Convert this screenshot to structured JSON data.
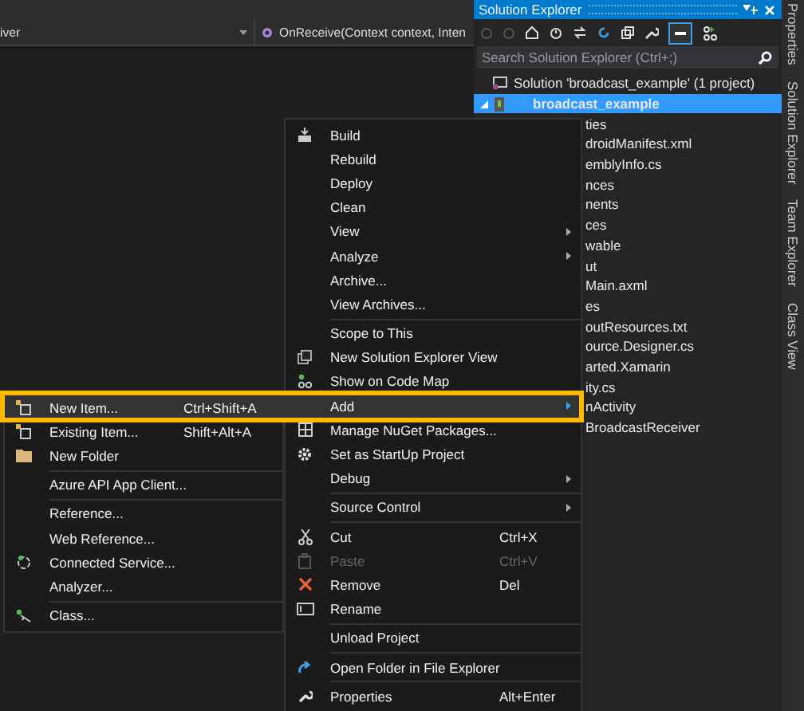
{
  "editor": {
    "type_dropdown": "iver",
    "member_dropdown": "OnReceive(Context context, Inten"
  },
  "solution_explorer": {
    "title": "Solution Explorer",
    "search": {
      "placeholder": "Search Solution Explorer (Ctrl+;)"
    },
    "tree": [
      {
        "label": "Solution 'broadcast_example' (1 project)",
        "selected": false,
        "kind": "solution"
      },
      {
        "label": "broadcast_example",
        "selected": true,
        "kind": "project"
      },
      {
        "label": "ties",
        "selected": false,
        "kind": "file"
      },
      {
        "label": "droidManifest.xml",
        "selected": false,
        "kind": "file"
      },
      {
        "label": "emblyInfo.cs",
        "selected": false,
        "kind": "file"
      },
      {
        "label": "nces",
        "selected": false,
        "kind": "file"
      },
      {
        "label": "nents",
        "selected": false,
        "kind": "file"
      },
      {
        "label": "ces",
        "selected": false,
        "kind": "gap"
      },
      {
        "label": "wable",
        "selected": false,
        "kind": "file"
      },
      {
        "label": "ut",
        "selected": false,
        "kind": "file"
      },
      {
        "label": "Main.axml",
        "selected": false,
        "kind": "file"
      },
      {
        "label": "es",
        "selected": false,
        "kind": "file"
      },
      {
        "label": "outResources.txt",
        "selected": false,
        "kind": "file"
      },
      {
        "label": "ource.Designer.cs",
        "selected": false,
        "kind": "file"
      },
      {
        "label": "arted.Xamarin",
        "selected": false,
        "kind": "file"
      },
      {
        "label": "ity.cs",
        "selected": false,
        "kind": "file"
      },
      {
        "label": "nActivity",
        "selected": false,
        "kind": "file"
      },
      {
        "label": "BroadcastReceiver",
        "selected": false,
        "kind": "file"
      }
    ]
  },
  "side_tabs": [
    "Properties",
    "Solution Explorer",
    "Team Explorer",
    "Class View"
  ],
  "context_menu": [
    {
      "kind": "item",
      "label": "Build",
      "submenu": false,
      "disabled": false,
      "selected": false
    },
    {
      "kind": "item",
      "label": "Rebuild",
      "submenu": false,
      "disabled": false,
      "selected": false
    },
    {
      "kind": "item",
      "label": "Deploy",
      "submenu": false,
      "disabled": false,
      "selected": false
    },
    {
      "kind": "item",
      "label": "Clean",
      "submenu": false,
      "disabled": false,
      "selected": false
    },
    {
      "kind": "item",
      "label": "View",
      "submenu": true,
      "disabled": false,
      "selected": false
    },
    {
      "kind": "item",
      "label": "Analyze",
      "submenu": true,
      "disabled": false,
      "selected": false
    },
    {
      "kind": "item",
      "label": "Archive...",
      "submenu": false,
      "disabled": false,
      "selected": false
    },
    {
      "kind": "item",
      "label": "View Archives...",
      "submenu": false,
      "disabled": false,
      "selected": false
    },
    {
      "kind": "separator"
    },
    {
      "kind": "item",
      "label": "Scope to This",
      "submenu": false,
      "disabled": false,
      "selected": false
    },
    {
      "kind": "item",
      "label": "New Solution Explorer View",
      "submenu": false,
      "disabled": false,
      "selected": false
    },
    {
      "kind": "item",
      "label": "Show on Code Map",
      "submenu": false,
      "disabled": false,
      "selected": false
    },
    {
      "kind": "item",
      "label": "Add",
      "submenu": true,
      "disabled": false,
      "selected": true
    },
    {
      "kind": "item",
      "label": "Manage NuGet Packages...",
      "submenu": false,
      "disabled": false,
      "selected": false
    },
    {
      "kind": "item",
      "label": "Set as StartUp Project",
      "submenu": false,
      "disabled": false,
      "selected": false
    },
    {
      "kind": "item",
      "label": "Debug",
      "submenu": true,
      "disabled": false,
      "selected": false
    },
    {
      "kind": "separator"
    },
    {
      "kind": "item",
      "label": "Source Control",
      "submenu": true,
      "disabled": false,
      "selected": false
    },
    {
      "kind": "separator"
    },
    {
      "kind": "item",
      "label": "Cut",
      "shortcut": "Ctrl+X",
      "submenu": false,
      "disabled": false,
      "selected": false
    },
    {
      "kind": "item",
      "label": "Paste",
      "shortcut": "Ctrl+V",
      "submenu": false,
      "disabled": true,
      "selected": false
    },
    {
      "kind": "item",
      "label": "Remove",
      "shortcut": "Del",
      "submenu": false,
      "disabled": false,
      "selected": false
    },
    {
      "kind": "item",
      "label": "Rename",
      "submenu": false,
      "disabled": false,
      "selected": false
    },
    {
      "kind": "separator"
    },
    {
      "kind": "item",
      "label": "Unload Project",
      "submenu": false,
      "disabled": false,
      "selected": false
    },
    {
      "kind": "separator"
    },
    {
      "kind": "item",
      "label": "Open Folder in File Explorer",
      "submenu": false,
      "disabled": false,
      "selected": false
    },
    {
      "kind": "separator"
    },
    {
      "kind": "item",
      "label": "Properties",
      "shortcut": "Alt+Enter",
      "submenu": false,
      "disabled": false,
      "selected": false
    }
  ],
  "add_submenu": [
    {
      "kind": "item",
      "label": "New Item...",
      "shortcut": "Ctrl+Shift+A",
      "selected": true
    },
    {
      "kind": "item",
      "label": "Existing Item...",
      "shortcut": "Shift+Alt+A",
      "selected": false
    },
    {
      "kind": "item",
      "label": "New Folder",
      "selected": false
    },
    {
      "kind": "separator"
    },
    {
      "kind": "item",
      "label": "Azure API App Client...",
      "selected": false
    },
    {
      "kind": "separator"
    },
    {
      "kind": "item",
      "label": "Reference...",
      "selected": false
    },
    {
      "kind": "item",
      "label": "Web Reference...",
      "selected": false
    },
    {
      "kind": "item",
      "label": "Connected Service...",
      "selected": false
    },
    {
      "kind": "item",
      "label": "Analyzer...",
      "selected": false
    },
    {
      "kind": "separator"
    },
    {
      "kind": "item",
      "label": "Class...",
      "selected": false
    }
  ]
}
